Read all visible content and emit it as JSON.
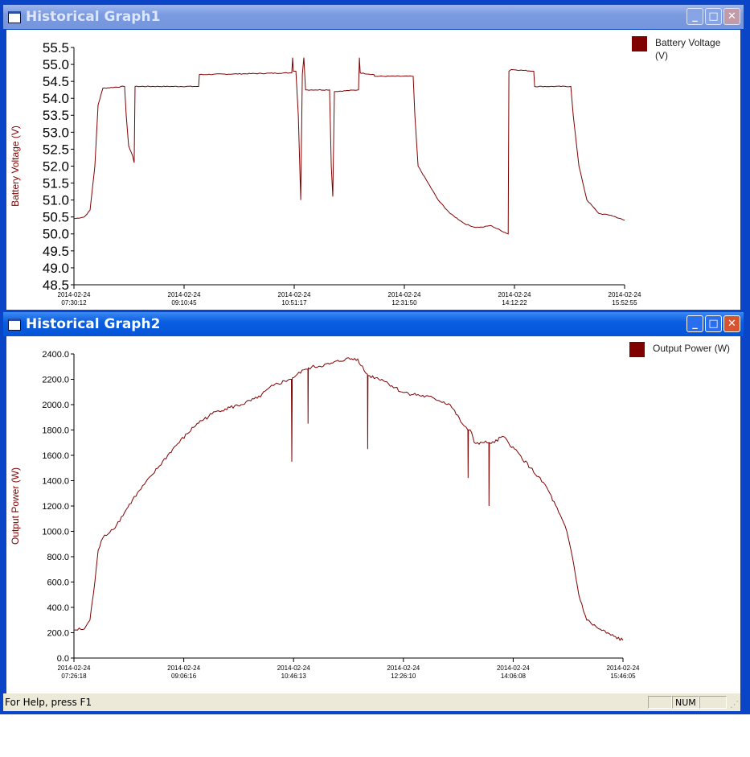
{
  "windows": [
    {
      "title": "Historical Graph1",
      "state": "inactive",
      "chart_data": {
        "type": "line",
        "title": "",
        "ylabel": "Battery Voltage (V)",
        "legend": "Battery Voltage (V)",
        "legend_lines": [
          "Battery Voltage",
          "(V)"
        ],
        "legend_position": "top-right",
        "ylim": [
          48.5,
          55.5
        ],
        "yticks": [
          "55.5",
          "55.0",
          "54.5",
          "54.0",
          "53.5",
          "53.0",
          "52.5",
          "52.0",
          "51.5",
          "51.0",
          "50.5",
          "50.0",
          "49.5",
          "49.0",
          "48.5"
        ],
        "xlim_minutes": [
          0,
          502.7
        ],
        "xticks": [
          {
            "date": "2014-02-24",
            "time": "07:30:12"
          },
          {
            "date": "2014-02-24",
            "time": "09:10:45"
          },
          {
            "date": "2014-02-24",
            "time": "10:51:17"
          },
          {
            "date": "2014-02-24",
            "time": "12:31:50"
          },
          {
            "date": "2014-02-24",
            "time": "14:12:22"
          },
          {
            "date": "2014-02-24",
            "time": "15:52:55"
          }
        ],
        "color": "#800000",
        "points": [
          [
            0,
            50.45
          ],
          [
            9.5,
            50.5
          ],
          [
            14.7,
            50.7
          ],
          [
            19.1,
            52
          ],
          [
            22,
            53.8
          ],
          [
            26.4,
            54.3
          ],
          [
            46.2,
            54.35
          ],
          [
            47.7,
            53.5
          ],
          [
            49.9,
            52.6
          ],
          [
            53.6,
            52.3
          ],
          [
            55,
            52.1
          ],
          [
            55.8,
            54.35
          ],
          [
            113.8,
            54.35
          ],
          [
            114.5,
            54.7
          ],
          [
            196.7,
            54.75
          ],
          [
            198.9,
            54.75
          ],
          [
            199.6,
            55.2
          ],
          [
            200.3,
            54.8
          ],
          [
            202.6,
            54.8
          ],
          [
            204.8,
            53.5
          ],
          [
            207,
            51
          ],
          [
            208.5,
            54.7
          ],
          [
            209.9,
            55.2
          ],
          [
            211.4,
            54.25
          ],
          [
            233.4,
            54.25
          ],
          [
            234.9,
            52
          ],
          [
            236.3,
            51.1
          ],
          [
            237.8,
            54.2
          ],
          [
            259.8,
            54.25
          ],
          [
            260.6,
            55.2
          ],
          [
            261.3,
            54.75
          ],
          [
            273.8,
            54.7
          ],
          [
            274.5,
            54.65
          ],
          [
            309.7,
            54.65
          ],
          [
            311.2,
            53.5
          ],
          [
            314.2,
            52
          ],
          [
            321.5,
            51.6
          ],
          [
            332.5,
            51
          ],
          [
            343.5,
            50.6
          ],
          [
            356.7,
            50.3
          ],
          [
            365.5,
            50.2
          ],
          [
            372.9,
            50.2
          ],
          [
            380.2,
            50.25
          ],
          [
            396.4,
            50
          ],
          [
            397.1,
            54.8
          ],
          [
            399.3,
            54.85
          ],
          [
            419.8,
            54.8
          ],
          [
            420.6,
            54.35
          ],
          [
            453.6,
            54.35
          ],
          [
            455.8,
            53.5
          ],
          [
            461,
            52
          ],
          [
            468.3,
            51
          ],
          [
            479.3,
            50.6
          ],
          [
            490.3,
            50.55
          ],
          [
            502.8,
            50.4
          ]
        ]
      }
    },
    {
      "title": "Historical Graph2",
      "state": "active",
      "chart_data": {
        "type": "line",
        "title": "",
        "ylabel": "Output Power (W)",
        "legend": "Output Power (W)",
        "legend_lines": [
          "Output Power (W)"
        ],
        "legend_position": "top-right",
        "ylim": [
          0,
          2400
        ],
        "yticks": [
          "2400.0",
          "2200.0",
          "2000.0",
          "1800.0",
          "1600.0",
          "1400.0",
          "1200.0",
          "1000.0",
          "800.0",
          "600.0",
          "400.0",
          "200.0",
          "0.0"
        ],
        "xlim_minutes": [
          0,
          500
        ],
        "xticks": [
          {
            "date": "2014-02-24",
            "time": "07:26:18"
          },
          {
            "date": "2014-02-24",
            "time": "09:06:16"
          },
          {
            "date": "2014-02-24",
            "time": "10:46:13"
          },
          {
            "date": "2014-02-24",
            "time": "12:26:10"
          },
          {
            "date": "2014-02-24",
            "time": "14:06:08"
          },
          {
            "date": "2014-02-24",
            "time": "15:46:05"
          }
        ],
        "color": "#800000",
        "points": [
          [
            0,
            220
          ],
          [
            9.5,
            230
          ],
          [
            14.6,
            300
          ],
          [
            19,
            600
          ],
          [
            22,
            850
          ],
          [
            26.4,
            950
          ],
          [
            38.8,
            1050
          ],
          [
            53.4,
            1250
          ],
          [
            71.7,
            1450
          ],
          [
            90,
            1650
          ],
          [
            112,
            1850
          ],
          [
            130.3,
            1950
          ],
          [
            152.3,
            2000
          ],
          [
            166.9,
            2050
          ],
          [
            181.5,
            2150
          ],
          [
            196.2,
            2200
          ],
          [
            198,
            2200
          ],
          [
            198.4,
            1550
          ],
          [
            198.8,
            2210
          ],
          [
            210.8,
            2280
          ],
          [
            213,
            2280
          ],
          [
            213.2,
            1850
          ],
          [
            213.5,
            2290
          ],
          [
            232.8,
            2320
          ],
          [
            247.4,
            2360
          ],
          [
            258.4,
            2360
          ],
          [
            265.7,
            2250
          ],
          [
            267.3,
            2240
          ],
          [
            267.5,
            1650
          ],
          [
            267.8,
            2230
          ],
          [
            280.4,
            2200
          ],
          [
            298.7,
            2100
          ],
          [
            328,
            2050
          ],
          [
            342.6,
            2000
          ],
          [
            353.6,
            1850
          ],
          [
            358.7,
            1800
          ],
          [
            358.9,
            1420
          ],
          [
            359.2,
            1800
          ],
          [
            360.9,
            1800
          ],
          [
            364.6,
            1700
          ],
          [
            371.9,
            1700
          ],
          [
            377.8,
            1700
          ],
          [
            378,
            1200
          ],
          [
            378.3,
            1700
          ],
          [
            382.9,
            1700
          ],
          [
            390.2,
            1750
          ],
          [
            401.2,
            1650
          ],
          [
            415.8,
            1500
          ],
          [
            430.4,
            1350
          ],
          [
            441.4,
            1150
          ],
          [
            448.8,
            1000
          ],
          [
            453.9,
            800
          ],
          [
            459.7,
            500
          ],
          [
            467,
            300
          ],
          [
            478,
            230
          ],
          [
            489,
            180
          ],
          [
            500,
            140
          ]
        ]
      }
    }
  ],
  "statusbar": {
    "help": "For Help, press F1",
    "num": "NUM"
  }
}
